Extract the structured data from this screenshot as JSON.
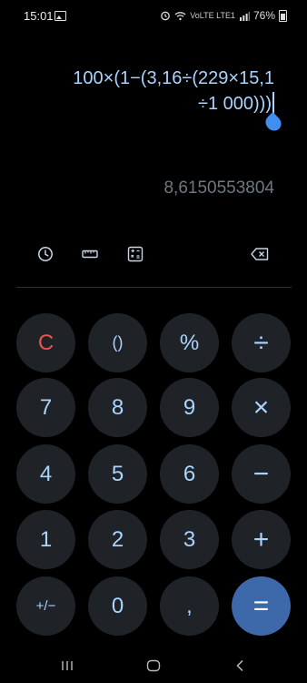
{
  "status_bar": {
    "time": "15:01",
    "network": "VoLTE LTE1",
    "battery": "76%"
  },
  "display": {
    "expression_line1": "100×(1−(3,16÷(229×15,1",
    "expression_line2": "÷1 000)))",
    "result": "8,6150553804"
  },
  "toolbar": {
    "history_icon": "clock-icon",
    "converter_icon": "ruler-icon",
    "scientific_icon": "scientific-calculator-icon",
    "backspace_icon": "backspace-icon"
  },
  "keys": {
    "clear": "C",
    "parentheses": "()",
    "percent": "%",
    "divide": "÷",
    "seven": "7",
    "eight": "8",
    "nine": "9",
    "multiply": "×",
    "four": "4",
    "five": "5",
    "six": "6",
    "minus": "−",
    "one": "1",
    "two": "2",
    "three": "3",
    "plus": "+",
    "plus_minus": "+/−",
    "zero": "0",
    "decimal": ",",
    "equals": "="
  },
  "colors": {
    "background": "#000000",
    "key_background": "#1f2328",
    "key_text": "#a9d4ff",
    "clear_text": "#e8544b",
    "equals_background": "#3d68aa",
    "result_text": "#6e7880"
  }
}
